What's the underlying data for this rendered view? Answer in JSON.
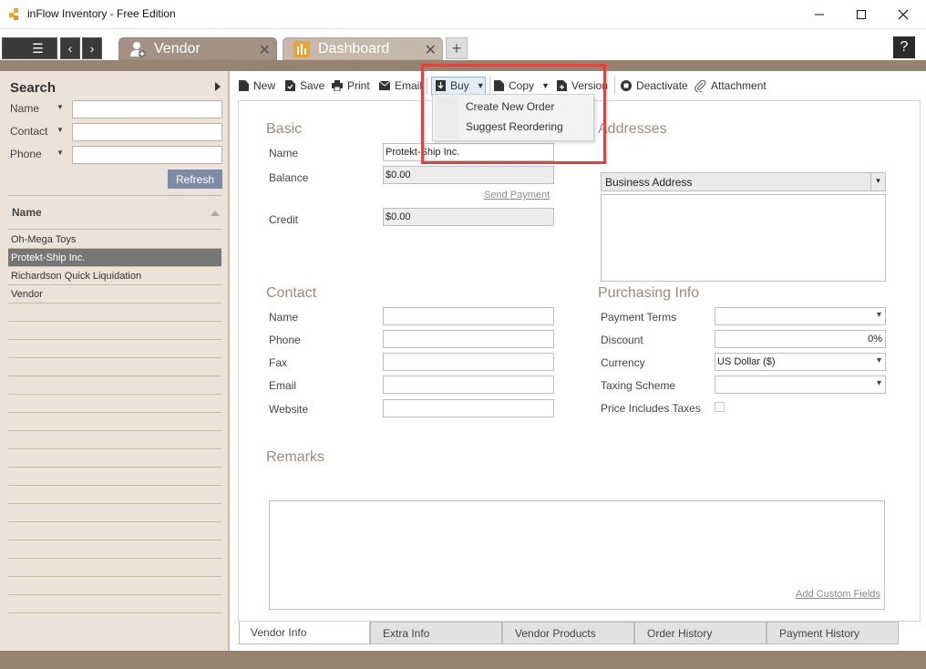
{
  "app": {
    "title": "inFlow Inventory - Free Edition"
  },
  "window": {
    "minimize": "minimize",
    "maximize": "maximize",
    "close": "close"
  },
  "tabs": [
    {
      "label": "Vendor",
      "close": "✕"
    },
    {
      "label": "Dashboard",
      "close": "✕"
    }
  ],
  "nav": {
    "menu": "☰",
    "back": "‹",
    "forward": "›",
    "new_tab": "+",
    "help": "?"
  },
  "sidebar": {
    "search_title": "Search",
    "fields": [
      {
        "label": "Name",
        "value": ""
      },
      {
        "label": "Contact",
        "value": ""
      },
      {
        "label": "Phone",
        "value": ""
      }
    ],
    "refresh_label": "Refresh",
    "list_header": "Name",
    "items": [
      "Oh-Mega Toys",
      "Protekt-Ship Inc.",
      "Richardson Quick Liquidation",
      "Vendor"
    ],
    "selected_index": 1
  },
  "toolbar": {
    "new": "New",
    "save": "Save",
    "print": "Print",
    "email": "Email",
    "buy": "Buy",
    "copy": "Copy",
    "version": "Version",
    "deactivate": "Deactivate",
    "attachment": "Attachment"
  },
  "buy_menu": {
    "items": [
      "Create New Order",
      "Suggest Reordering"
    ]
  },
  "basic": {
    "title": "Basic",
    "name_label": "Name",
    "name_value": "Protekt-Ship Inc.",
    "balance_label": "Balance",
    "balance_value": "$0.00",
    "send_payment": "Send Payment",
    "credit_label": "Credit",
    "credit_value": "$0.00"
  },
  "addresses": {
    "title": "Addresses",
    "type": "Business Address"
  },
  "contact": {
    "title": "Contact",
    "fields": [
      {
        "label": "Name",
        "value": ""
      },
      {
        "label": "Phone",
        "value": ""
      },
      {
        "label": "Fax",
        "value": ""
      },
      {
        "label": "Email",
        "value": ""
      },
      {
        "label": "Website",
        "value": ""
      }
    ]
  },
  "purchasing": {
    "title": "Purchasing Info",
    "payment_terms_label": "Payment Terms",
    "payment_terms_value": "",
    "discount_label": "Discount",
    "discount_value": "0%",
    "currency_label": "Currency",
    "currency_value": "US Dollar  ($)",
    "taxing_label": "Taxing Scheme",
    "taxing_value": "",
    "price_includes_label": "Price Includes Taxes",
    "price_includes_checked": false
  },
  "remarks": {
    "title": "Remarks",
    "value": ""
  },
  "add_custom_fields": "Add Custom Fields",
  "bottom_tabs": [
    "Vendor Info",
    "Extra Info",
    "Vendor Products",
    "Order History",
    "Payment History"
  ],
  "colors": {
    "accent_band": "#968473",
    "highlight": "#e5413c",
    "refresh": "#7d8ba7"
  }
}
